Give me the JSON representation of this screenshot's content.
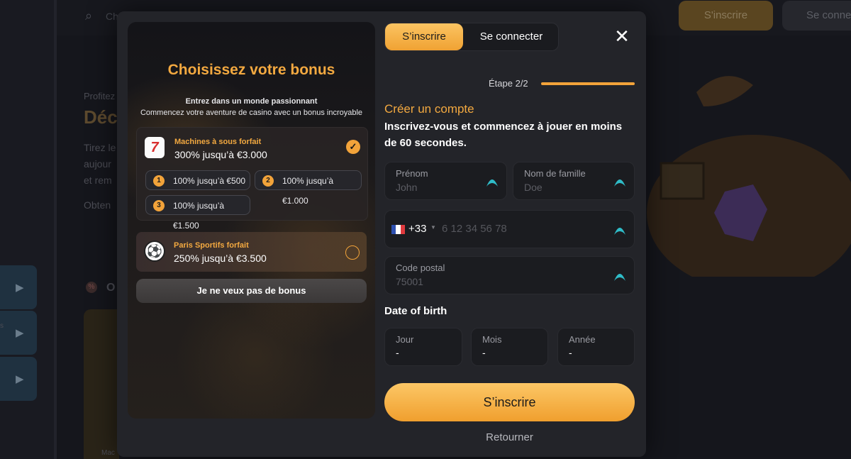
{
  "background": {
    "search_placeholder": "Ch",
    "signup_label": "S'inscrire",
    "login_label": "Se conne",
    "promo_small": "Profitez",
    "promo_big": "Déc",
    "promo_lines": [
      "Tirez le",
      "aujour",
      "et rem",
      "Obten"
    ],
    "section_label": "O",
    "rail_label": "s",
    "card_caption": "Mac"
  },
  "tabs": {
    "signup": "S’inscrire",
    "login": "Se connecter"
  },
  "bonus": {
    "title": "Choisissez votre bonus",
    "subtitle_1": "Entrez dans un monde passionnant",
    "subtitle_2": "Commencez votre aventure de casino avec un bonus incroyable",
    "offers": [
      {
        "name": "Machines à sous forfait",
        "amount": "300% jusqu’à €3.000",
        "selected": true,
        "icon": "slot-machine-icon",
        "tiers": [
          {
            "num": "1",
            "label": "100% jusqu’à €500"
          },
          {
            "num": "2",
            "label": "100% jusqu’à €1.000"
          },
          {
            "num": "3",
            "label": "100% jusqu’à €1.500"
          }
        ]
      },
      {
        "name": "Paris Sportifs forfait",
        "amount": "250% jusqu’à €3.500",
        "selected": false,
        "icon": "soccer-ball-icon"
      }
    ],
    "no_bonus": "Je ne veux pas de bonus"
  },
  "form": {
    "step": "Étape 2/2",
    "step_progress": 1.0,
    "title": "Créer un compte",
    "description": "Inscrivez-vous et commencez à jouer en moins de 60 secondes.",
    "first_name": {
      "label": "Prénom",
      "placeholder": "John"
    },
    "last_name": {
      "label": "Nom de famille",
      "placeholder": "Doe"
    },
    "phone": {
      "country_code": "+33",
      "placeholder": "6 12 34 56 78"
    },
    "postal_code": {
      "label": "Code postal",
      "placeholder": "75001"
    },
    "dob_title": "Date of birth",
    "day": {
      "label": "Jour",
      "value": "-"
    },
    "month": {
      "label": "Mois",
      "value": "-"
    },
    "year": {
      "label": "Année",
      "value": "-"
    },
    "submit": "S’inscrire",
    "back": "Retourner"
  },
  "colors": {
    "accent": "#f2a33a",
    "valid": "#2fbcc8",
    "modal_bg": "#232429"
  }
}
